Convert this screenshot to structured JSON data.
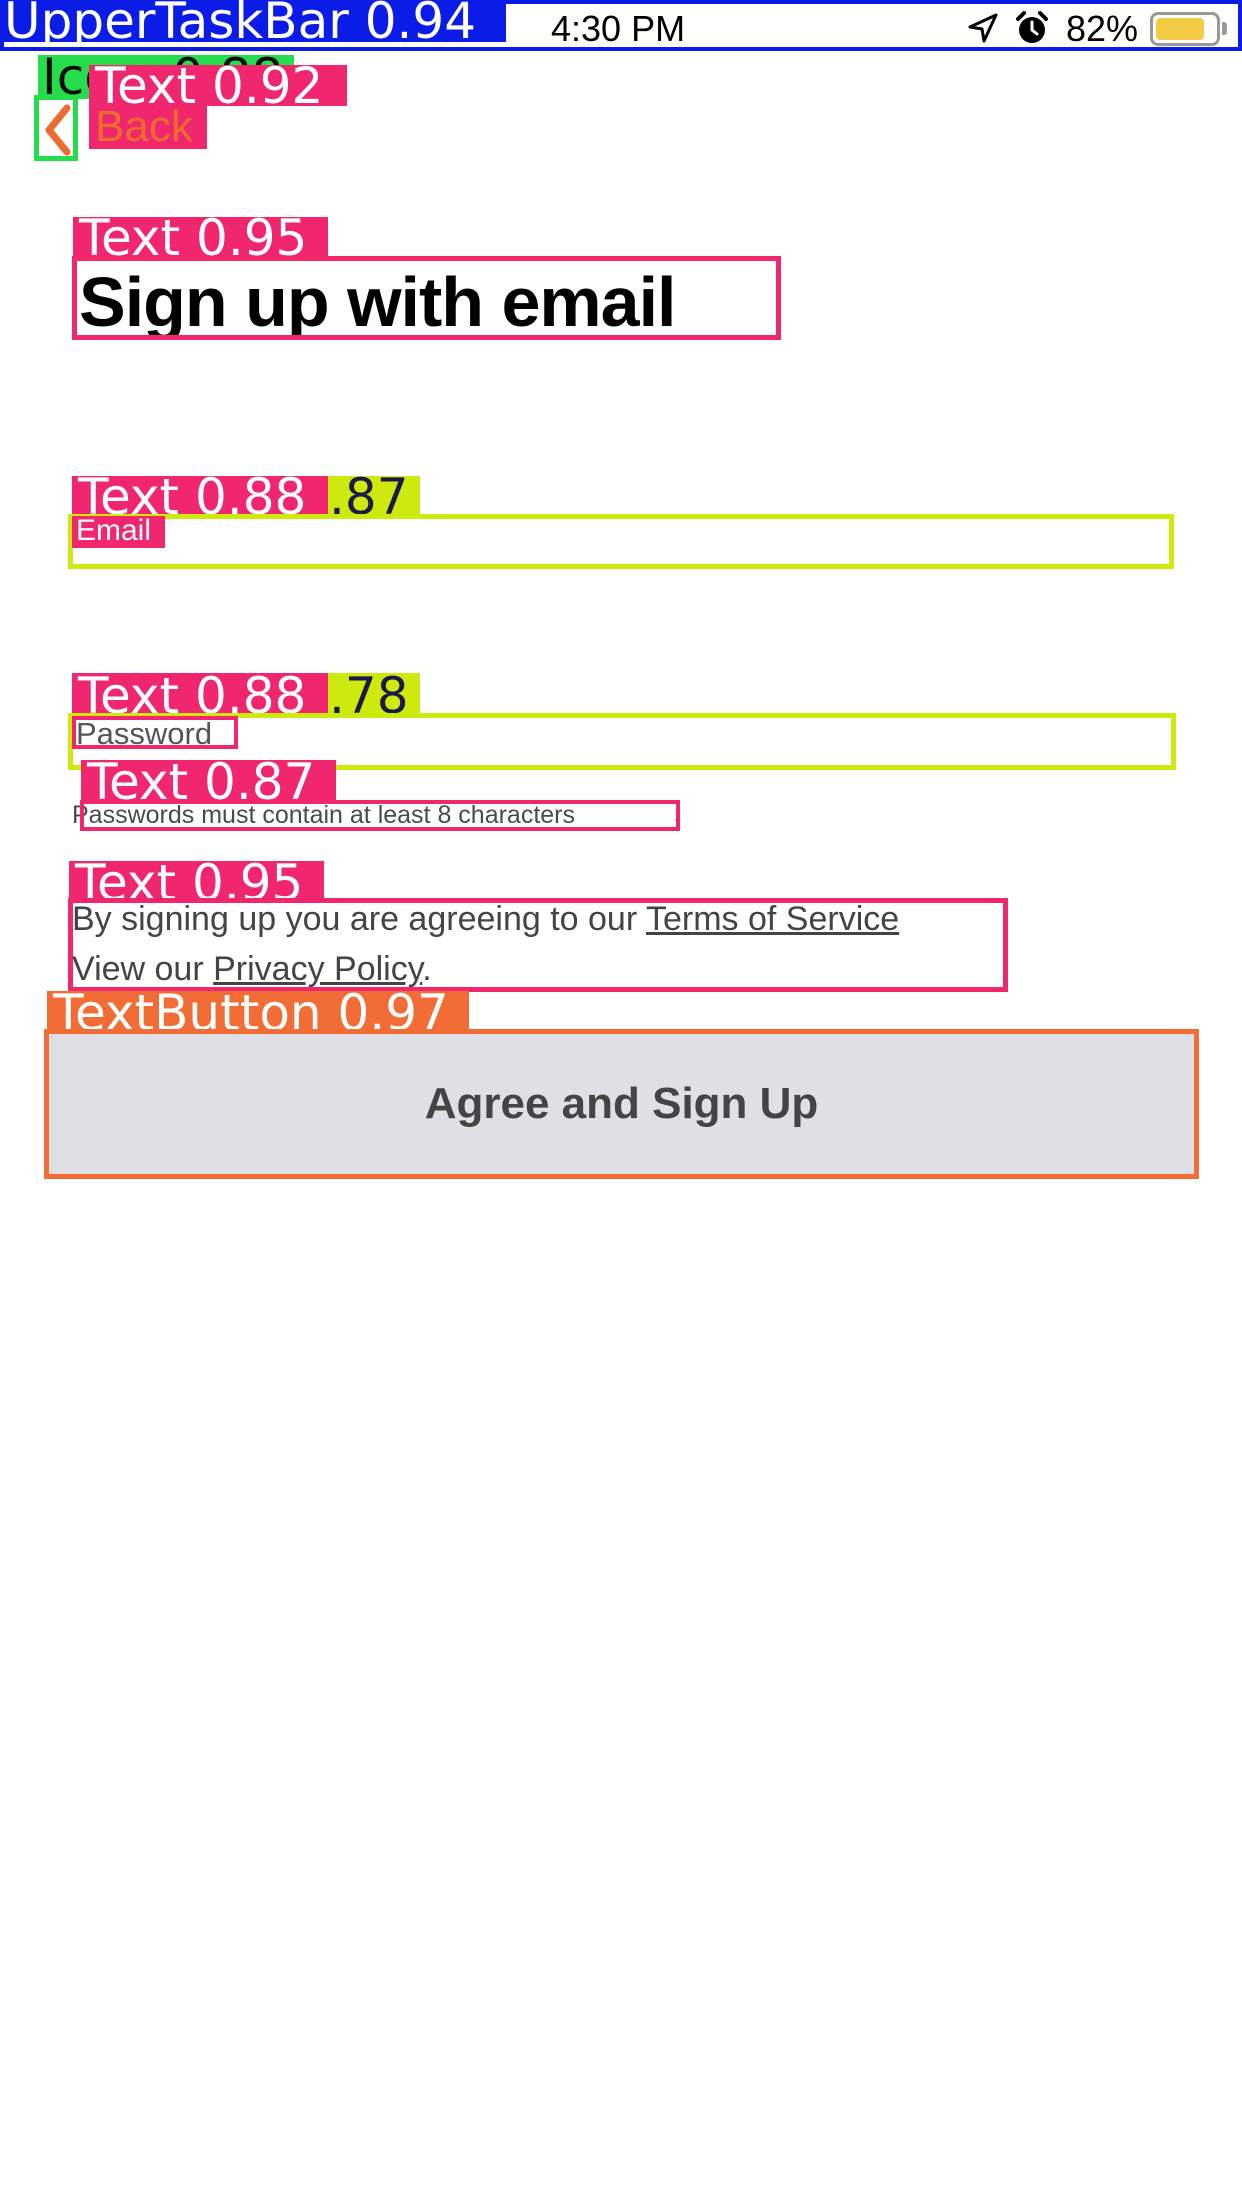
{
  "status_bar": {
    "time": "4:30 PM",
    "battery_percent": "82%",
    "battery_level": 0.82,
    "location_icon": "location-arrow-icon",
    "alarm_icon": "alarm-clock-icon"
  },
  "nav": {
    "back_label": "Back",
    "back_icon": "chevron-left-icon"
  },
  "page": {
    "title": "Sign up with email"
  },
  "form": {
    "email_placeholder": "Email",
    "password_placeholder": "Password",
    "password_hint": "Passwords must contain at least 8 characters"
  },
  "legal": {
    "prefix": "By signing up you are agreeing to our ",
    "terms_link": "Terms of Service",
    "line2_prefix": "View our ",
    "privacy_link": "Privacy Policy",
    "line2_suffix": "."
  },
  "submit": {
    "label": "Agree and Sign Up"
  },
  "annotations": {
    "upper_taskbar": "UpperTaskBar 0.94",
    "icon_partial": "Ico",
    "icon_partial_score": "0.88",
    "back_text": "Text 0.92",
    "title_text": "Text 0.95",
    "email_text": "Text 0.88",
    "email_field_score": ".87",
    "password_text": "Text 0.88",
    "password_field_score": ".78",
    "hint_text": "Text 0.87",
    "legal_text": "Text 0.95",
    "button_text": "TextButton 0.97"
  },
  "colors": {
    "status_bar_border": "#0a1ce6",
    "icon_box": "#25dd4a",
    "text_box": "#f0266e",
    "field_box": "#cde90d",
    "button_box": "#f26c36",
    "button_fill": "#dfe0e6",
    "battery": "#f3cb45",
    "back_orange": "#ec6b2f"
  }
}
